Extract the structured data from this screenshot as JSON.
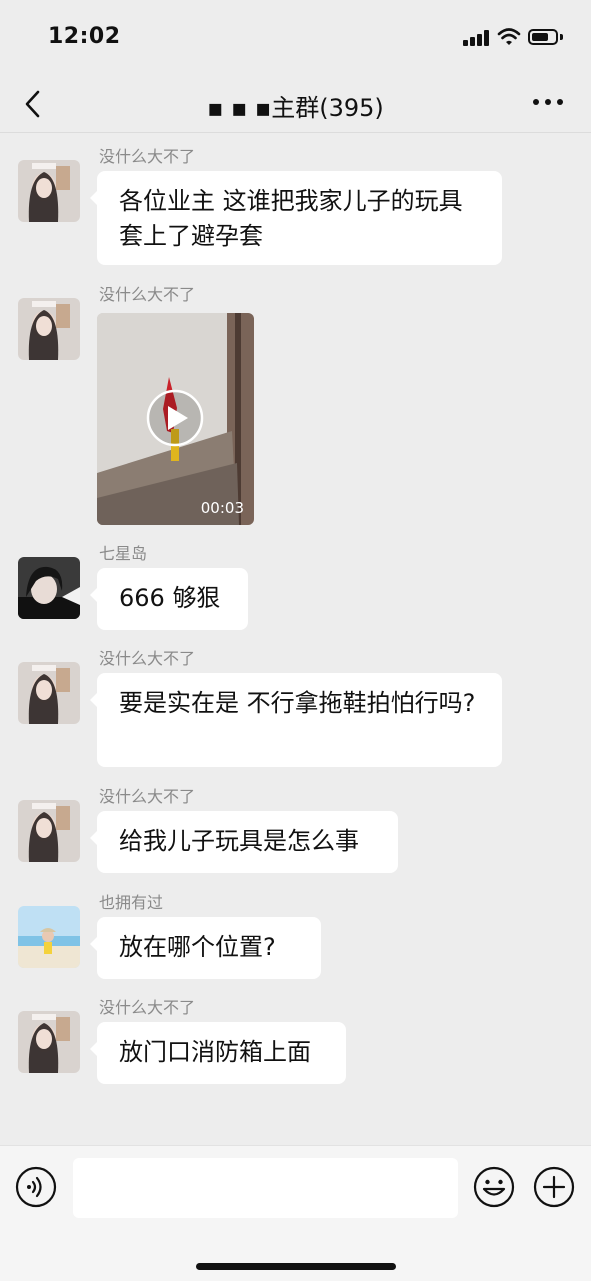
{
  "status_bar": {
    "time": "12:02"
  },
  "header": {
    "title": "▪ ▪ ▪主群(395)"
  },
  "messages": [
    {
      "sender": "没什么大不了",
      "text": "各位业主 这谁把我家儿子的玩具套上了避孕套"
    },
    {
      "sender": "没什么大不了",
      "video_duration": "00:03"
    },
    {
      "sender": "七星岛",
      "text": "666 够狠"
    },
    {
      "sender": "没什么大不了",
      "text": "要是实在是 不行拿拖鞋拍怕行吗?"
    },
    {
      "sender": "没什么大不了",
      "text": "给我儿子玩具是怎么事"
    },
    {
      "sender": "也拥有过",
      "text": "放在哪个位置?"
    },
    {
      "sender": "没什么大不了",
      "text": "放门口消防箱上面"
    }
  ],
  "input_bar": {
    "value": ""
  },
  "colors": {
    "background": "#ededed",
    "bubble": "#ffffff",
    "sender": "#8a8a8a"
  }
}
